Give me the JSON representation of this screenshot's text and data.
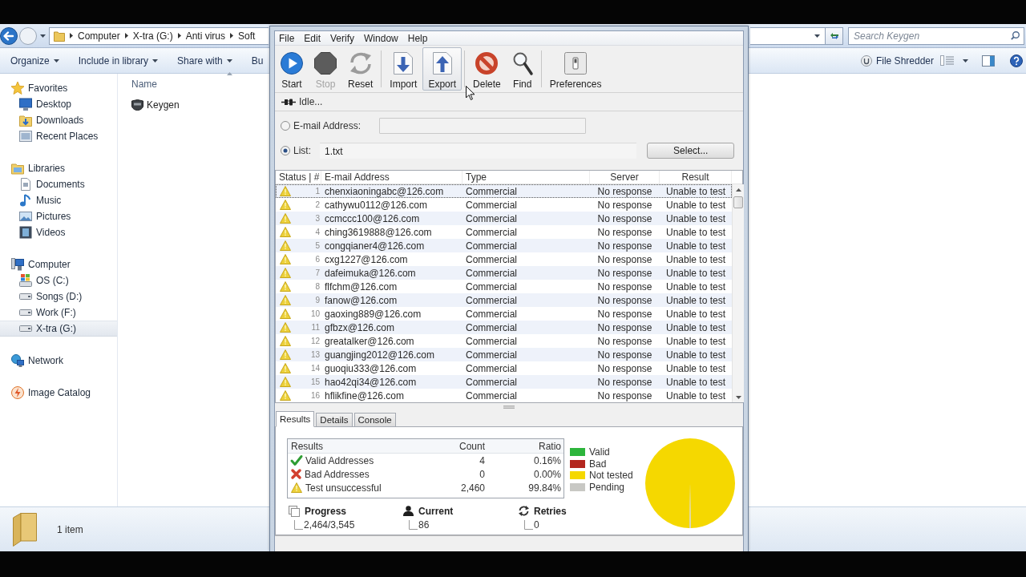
{
  "explorer": {
    "breadcrumb": [
      "Computer",
      "X-tra (G:)",
      "Anti virus",
      "Soft"
    ],
    "search": {
      "placeholder": "Search Keygen"
    },
    "commands": [
      {
        "label": "Organize",
        "menu": true
      },
      {
        "label": "Include in library",
        "menu": true
      },
      {
        "label": "Share with",
        "menu": true
      },
      {
        "label": "Bu",
        "menu": false
      }
    ],
    "shredder": {
      "label": "File Shredder"
    },
    "navigation": [
      {
        "label": "Favorites",
        "selected": false,
        "children": [
          {
            "label": "Desktop",
            "selected": false
          },
          {
            "label": "Downloads",
            "selected": false
          },
          {
            "label": "Recent Places",
            "selected": false
          }
        ]
      },
      {
        "label": "Libraries",
        "selected": false,
        "children": [
          {
            "label": "Documents",
            "selected": false
          },
          {
            "label": "Music",
            "selected": false
          },
          {
            "label": "Pictures",
            "selected": false
          },
          {
            "label": "Videos",
            "selected": false
          }
        ]
      },
      {
        "label": "Computer",
        "selected": false,
        "children": [
          {
            "label": "OS (C:)",
            "selected": false
          },
          {
            "label": "Songs (D:)",
            "selected": false
          },
          {
            "label": "Work (F:)",
            "selected": false
          },
          {
            "label": "X-tra (G:)",
            "selected": true
          }
        ]
      },
      {
        "label": "Network",
        "selected": false
      },
      {
        "label": "Image Catalog",
        "selected": false
      }
    ],
    "file_list": {
      "column": "Name",
      "files": [
        {
          "name": "Keygen"
        }
      ]
    },
    "status_bar": {
      "item_count": "1 item"
    }
  },
  "app": {
    "menu": [
      "File",
      "Edit",
      "Verify",
      "Window",
      "Help"
    ],
    "toolbar": [
      [
        {
          "label": "Start",
          "disabled": false,
          "pressed": false
        },
        {
          "label": "Stop",
          "disabled": true,
          "pressed": false
        },
        {
          "label": "Reset",
          "disabled": false,
          "pressed": false
        }
      ],
      [
        {
          "label": "Import",
          "disabled": false,
          "pressed": false
        },
        {
          "label": "Export",
          "disabled": false,
          "pressed": true
        }
      ],
      [
        {
          "label": "Delete",
          "disabled": false,
          "pressed": false
        },
        {
          "label": "Find",
          "disabled": false,
          "pressed": false
        }
      ],
      [
        {
          "label": "Preferences",
          "disabled": false,
          "pressed": false
        }
      ]
    ],
    "status": "Idle...",
    "source": {
      "email": {
        "label": "E-mail Address:",
        "selected": false
      },
      "list": {
        "label": "List:",
        "selected": true,
        "value": "1.txt"
      },
      "select_button": "Select..."
    },
    "table": {
      "columns": [
        "Status | #",
        "E-mail Address",
        "Type",
        "Server",
        "Result"
      ],
      "rows": [
        {
          "kind": "warning",
          "number": "1",
          "email": "chenxiaoningabc@126.com",
          "type": "Commercial",
          "server": "No response",
          "result": "Unable to test",
          "focused": true
        },
        {
          "kind": "warning",
          "number": "2",
          "email": "cathywu0112@126.com",
          "type": "Commercial",
          "server": "No response",
          "result": "Unable to test",
          "focused": false
        },
        {
          "kind": "warning",
          "number": "3",
          "email": "ccmccc100@126.com",
          "type": "Commercial",
          "server": "No response",
          "result": "Unable to test",
          "focused": false
        },
        {
          "kind": "warning",
          "number": "4",
          "email": "ching3619888@126.com",
          "type": "Commercial",
          "server": "No response",
          "result": "Unable to test",
          "focused": false
        },
        {
          "kind": "warning",
          "number": "5",
          "email": "congqianer4@126.com",
          "type": "Commercial",
          "server": "No response",
          "result": "Unable to test",
          "focused": false
        },
        {
          "kind": "warning",
          "number": "6",
          "email": "cxg1227@126.com",
          "type": "Commercial",
          "server": "No response",
          "result": "Unable to test",
          "focused": false
        },
        {
          "kind": "warning",
          "number": "7",
          "email": "dafeimuka@126.com",
          "type": "Commercial",
          "server": "No response",
          "result": "Unable to test",
          "focused": false
        },
        {
          "kind": "warning",
          "number": "8",
          "email": "flfchm@126.com",
          "type": "Commercial",
          "server": "No response",
          "result": "Unable to test",
          "focused": false
        },
        {
          "kind": "warning",
          "number": "9",
          "email": "fanow@126.com",
          "type": "Commercial",
          "server": "No response",
          "result": "Unable to test",
          "focused": false
        },
        {
          "kind": "warning",
          "number": "10",
          "email": "gaoxing889@126.com",
          "type": "Commercial",
          "server": "No response",
          "result": "Unable to test",
          "focused": false
        },
        {
          "kind": "warning",
          "number": "11",
          "email": "gfbzx@126.com",
          "type": "Commercial",
          "server": "No response",
          "result": "Unable to test",
          "focused": false
        },
        {
          "kind": "warning",
          "number": "12",
          "email": "greatalker@126.com",
          "type": "Commercial",
          "server": "No response",
          "result": "Unable to test",
          "focused": false
        },
        {
          "kind": "warning",
          "number": "13",
          "email": "guangjing2012@126.com",
          "type": "Commercial",
          "server": "No response",
          "result": "Unable to test",
          "focused": false
        },
        {
          "kind": "warning",
          "number": "14",
          "email": "guoqiu333@126.com",
          "type": "Commercial",
          "server": "No response",
          "result": "Unable to test",
          "focused": false
        },
        {
          "kind": "warning",
          "number": "15",
          "email": "hao42qi34@126.com",
          "type": "Commercial",
          "server": "No response",
          "result": "Unable to test",
          "focused": false
        },
        {
          "kind": "warning",
          "number": "16",
          "email": "hflikfine@126.com",
          "type": "Commercial",
          "server": "No response",
          "result": "Unable to test",
          "focused": false
        }
      ]
    },
    "tabs": [
      {
        "label": "Results",
        "selected": true
      },
      {
        "label": "Details",
        "selected": false
      },
      {
        "label": "Console",
        "selected": false
      }
    ],
    "results": {
      "columns": [
        "Results",
        "Count",
        "Ratio"
      ],
      "rows": [
        {
          "kind": "valid",
          "label": "Valid Addresses",
          "count": "4",
          "ratio": "0.16%"
        },
        {
          "kind": "bad",
          "label": "Bad Addresses",
          "count": "0",
          "ratio": "0.00%"
        },
        {
          "kind": "warning",
          "label": "Test unsuccessful",
          "count": "2,460",
          "ratio": "99.84%"
        }
      ]
    },
    "legend": [
      {
        "label": "Valid",
        "color": "#2db53c"
      },
      {
        "label": "Bad",
        "color": "#b3261e"
      },
      {
        "label": "Not tested",
        "color": "#f5d800"
      },
      {
        "label": "Pending",
        "color": "#c8c8c4"
      }
    ],
    "stats": [
      {
        "kind": "progress",
        "label": "Progress",
        "value": "2,464/3,545"
      },
      {
        "kind": "current",
        "label": "Current",
        "value": "86"
      },
      {
        "kind": "retries",
        "label": "Retries",
        "value": "0"
      }
    ]
  }
}
